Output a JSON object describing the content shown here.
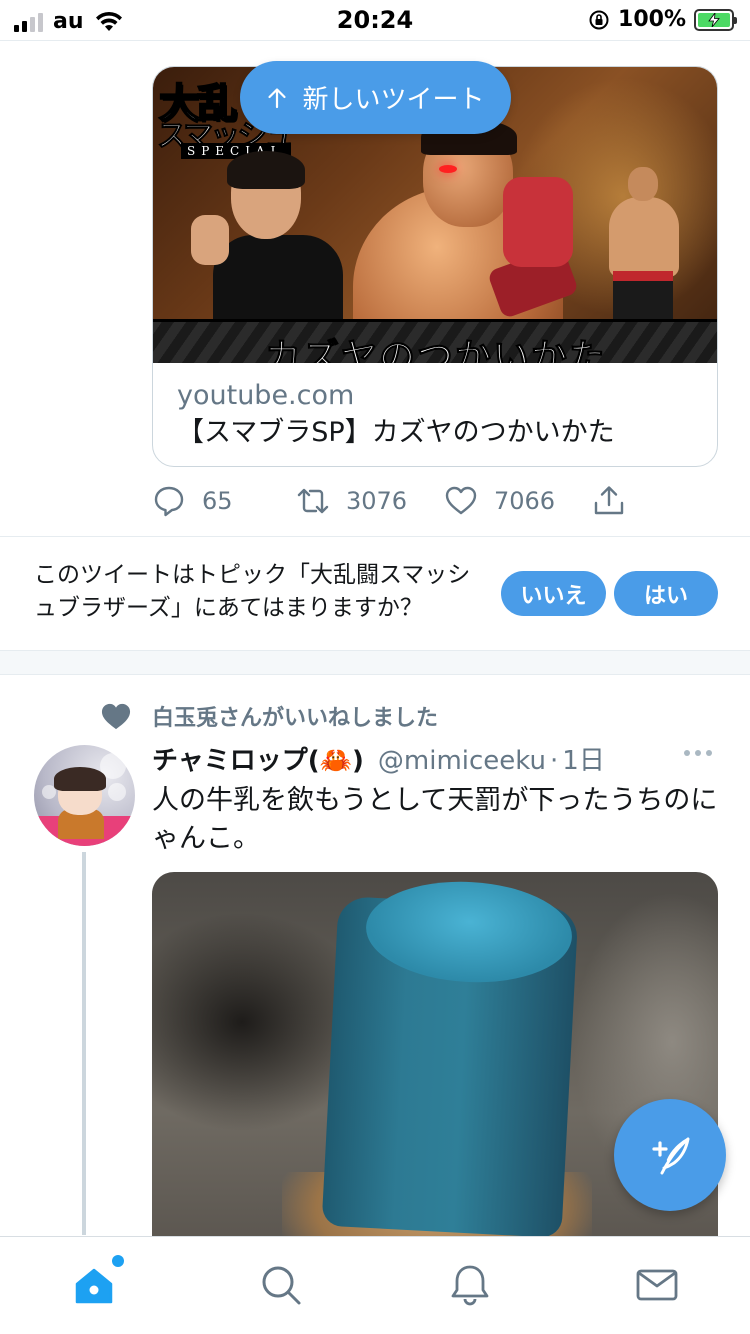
{
  "status_bar": {
    "carrier": "au",
    "time": "20:24",
    "battery": "100%",
    "icons": [
      "signal-icon",
      "wifi-icon",
      "orientation-lock-icon",
      "battery-charging-icon"
    ]
  },
  "new_tweets_pill": {
    "label": "新しいツイート",
    "icon": "arrow-up-icon"
  },
  "link_card": {
    "image_banner_text": "カズヤのつかいかた",
    "image_logo_line1": "大乱",
    "image_logo_line2": "スマッシュ",
    "image_logo_special": "SPECIAL",
    "domain": "youtube.com",
    "title": "【スマブラSP】カズヤのつかいかた"
  },
  "tweet1_actions": {
    "reply_count": "65",
    "retweet_count": "3076",
    "like_count": "7066"
  },
  "topic_prompt": {
    "text": "このツイートはトピック「大乱闘スマッシュブラザーズ」にあてはまりますか？",
    "no_label": "いいえ",
    "yes_label": "はい"
  },
  "tweet2": {
    "social_context": "白玉兎さんがいいねしました",
    "display_name": "チャミロップ(🦀)",
    "handle": "@mimiceeku",
    "dot": "·",
    "time": "1日",
    "text": "人の牛乳を飲もうとして天罰が下ったうちのにゃんこ。"
  },
  "tab_bar": {
    "tabs": [
      "home-icon",
      "search-icon",
      "notifications-icon",
      "messages-icon"
    ]
  },
  "colors": {
    "accent": "#4a9ce8",
    "secondary_text": "#657786",
    "border": "#ccd6dd"
  }
}
